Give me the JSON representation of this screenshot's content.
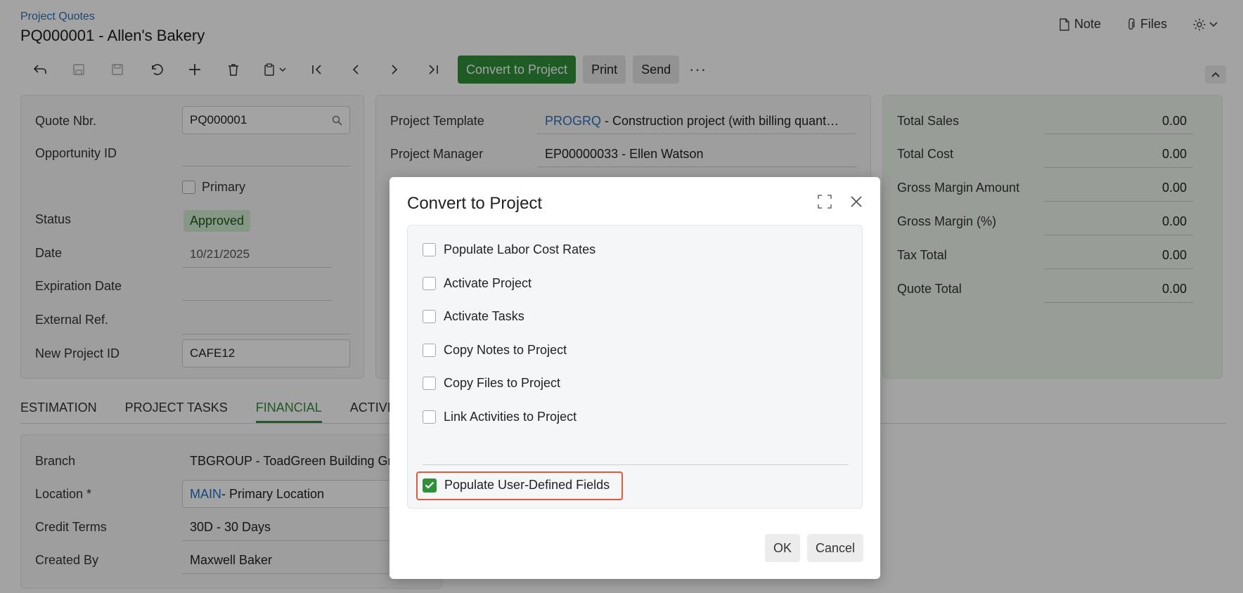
{
  "header": {
    "breadcrumb": "Project Quotes",
    "title": "PQ000001 - Allen's Bakery",
    "note_label": "Note",
    "files_label": "Files"
  },
  "toolbar": {
    "convert_label": "Convert to Project",
    "print_label": "Print",
    "send_label": "Send",
    "more_label": "···"
  },
  "summary": {
    "quote_nbr_label": "Quote Nbr.",
    "quote_nbr_value": "PQ000001",
    "opportunity_label": "Opportunity ID",
    "primary_label": "Primary",
    "status_label": "Status",
    "status_value": "Approved",
    "date_label": "Date",
    "date_value": "10/21/2025",
    "expiration_label": "Expiration Date",
    "external_ref_label": "External Ref.",
    "new_project_label": "New Project ID",
    "new_project_value": "CAFE12"
  },
  "project": {
    "template_label": "Project Template",
    "template_code": "PROGRQ",
    "template_desc": " - Construction project (with billing quant…",
    "manager_label": "Project Manager",
    "manager_value": "EP00000033 - Ellen Watson"
  },
  "totals": {
    "items": [
      {
        "label": "Total Sales",
        "value": "0.00"
      },
      {
        "label": "Total Cost",
        "value": "0.00"
      },
      {
        "label": "Gross Margin Amount",
        "value": "0.00"
      },
      {
        "label": "Gross Margin (%)",
        "value": "0.00"
      },
      {
        "label": "Tax Total",
        "value": "0.00"
      },
      {
        "label": "Quote Total",
        "value": "0.00"
      }
    ]
  },
  "tabs": [
    {
      "label": "ESTIMATION"
    },
    {
      "label": "PROJECT TASKS"
    },
    {
      "label": "FINANCIAL"
    },
    {
      "label": "ACTIVITI"
    }
  ],
  "financial": {
    "branch_label": "Branch",
    "branch_value": "TBGROUP - ToadGreen Building Gr…",
    "location_label": "Location *",
    "location_code": "MAIN",
    "location_desc": " - Primary Location",
    "credit_label": "Credit Terms",
    "credit_value": "30D - 30 Days",
    "created_label": "Created By",
    "created_value": "Maxwell Baker"
  },
  "dialog": {
    "title": "Convert to Project",
    "options": [
      {
        "label": "Populate Labor Cost Rates",
        "checked": false
      },
      {
        "label": "Activate Project",
        "checked": false
      },
      {
        "label": "Activate Tasks",
        "checked": false
      },
      {
        "label": "Copy Notes to Project",
        "checked": false
      },
      {
        "label": "Copy Files to Project",
        "checked": false
      },
      {
        "label": "Link Activities to Project",
        "checked": false
      }
    ],
    "udf_label": "Populate User-Defined Fields",
    "ok_label": "OK",
    "cancel_label": "Cancel"
  },
  "colors": {
    "accent": "#2f8f3a",
    "link": "#2e6fbf",
    "highlight": "#e05a3a"
  }
}
